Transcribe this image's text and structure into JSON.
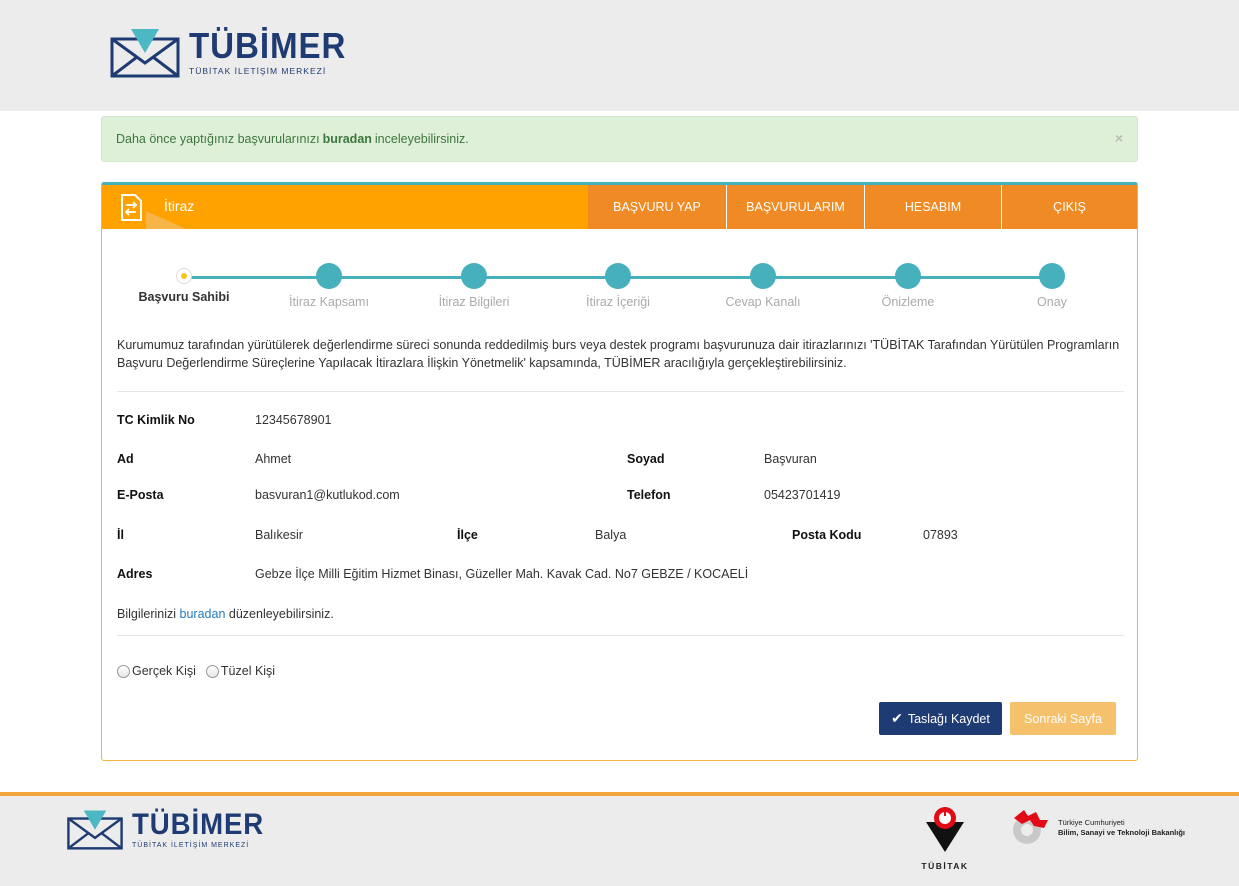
{
  "header": {
    "brand": "TÜBİMER",
    "brand_sub": "TÜBİTAK İLETİŞİM MERKEZİ"
  },
  "alert": {
    "text_before": "Daha önce yaptığınız başvurularınızı",
    "link": "buradan",
    "text_after": "inceleyebilirsiniz.",
    "close": "×"
  },
  "panel": {
    "title": "İtiraz",
    "nav": [
      {
        "label": "BAŞVURU YAP"
      },
      {
        "label": "BAŞVURULARIM"
      },
      {
        "label": "HESABIM"
      },
      {
        "label": "ÇIKIŞ"
      }
    ]
  },
  "steps": [
    {
      "label": "Başvuru Sahibi"
    },
    {
      "label": "İtiraz Kapsamı"
    },
    {
      "label": "İtiraz Bilgileri"
    },
    {
      "label": "İtiraz İçeriği"
    },
    {
      "label": "Cevap Kanalı"
    },
    {
      "label": "Önizleme"
    },
    {
      "label": "Onay"
    }
  ],
  "intro": "Kurumumuz tarafından yürütülerek değerlendirme süreci sonunda reddedilmiş burs veya destek programı başvurunuza dair itirazlarınızı 'TÜBİTAK Tarafından Yürütülen Programların Başvuru Değerlendirme Süreçlerine Yapılacak İtirazlara İlişkin Yönetmelik' kapsamında, TÜBİMER aracılığıyla gerçekleştirebilirsiniz.",
  "applicant": {
    "tc_label": "TC Kimlik No",
    "tc": "12345678901",
    "ad_label": "Ad",
    "ad": "Ahmet",
    "soyad_label": "Soyad",
    "soyad": "Başvuran",
    "eposta_label": "E-Posta",
    "eposta": "basvuran1@kutlukod.com",
    "telefon_label": "Telefon",
    "telefon": "05423701419",
    "il_label": "İl",
    "il": "Balıkesir",
    "ilce_label": "İlçe",
    "ilce": "Balya",
    "posta_label": "Posta Kodu",
    "posta": "07893",
    "adres_label": "Adres",
    "adres": "Gebze İlçe Milli Eğitim Hizmet Binası, Güzeller Mah. Kavak Cad. No7 GEBZE / KOCAELİ"
  },
  "edit": {
    "before": "Bilgilerinizi",
    "link": "buradan",
    "after": "düzenleyebilirsiniz."
  },
  "radios": {
    "gercek": "Gerçek Kişi",
    "tuzel": "Tüzel Kişi"
  },
  "buttons": {
    "save_draft": "Taslağı Kaydet",
    "next": "Sonraki Sayfa"
  },
  "footer": {
    "brand": "TÜBİMER",
    "brand_sub": "TÜBİTAK İLETİŞİM MERKEZİ",
    "tubitak": "TÜBİTAK",
    "ministry_line1": "Türkiye Cumhuriyeti",
    "ministry_line2": "Bilim, Sanayi ve Teknoloji Bakanlığı"
  },
  "colors": {
    "brand_navy": "#1f3b73",
    "accent_orange": "#ffa200",
    "nav_orange": "#f08a24",
    "teal": "#46b1bd",
    "alert_green_bg": "#dff0d8"
  }
}
